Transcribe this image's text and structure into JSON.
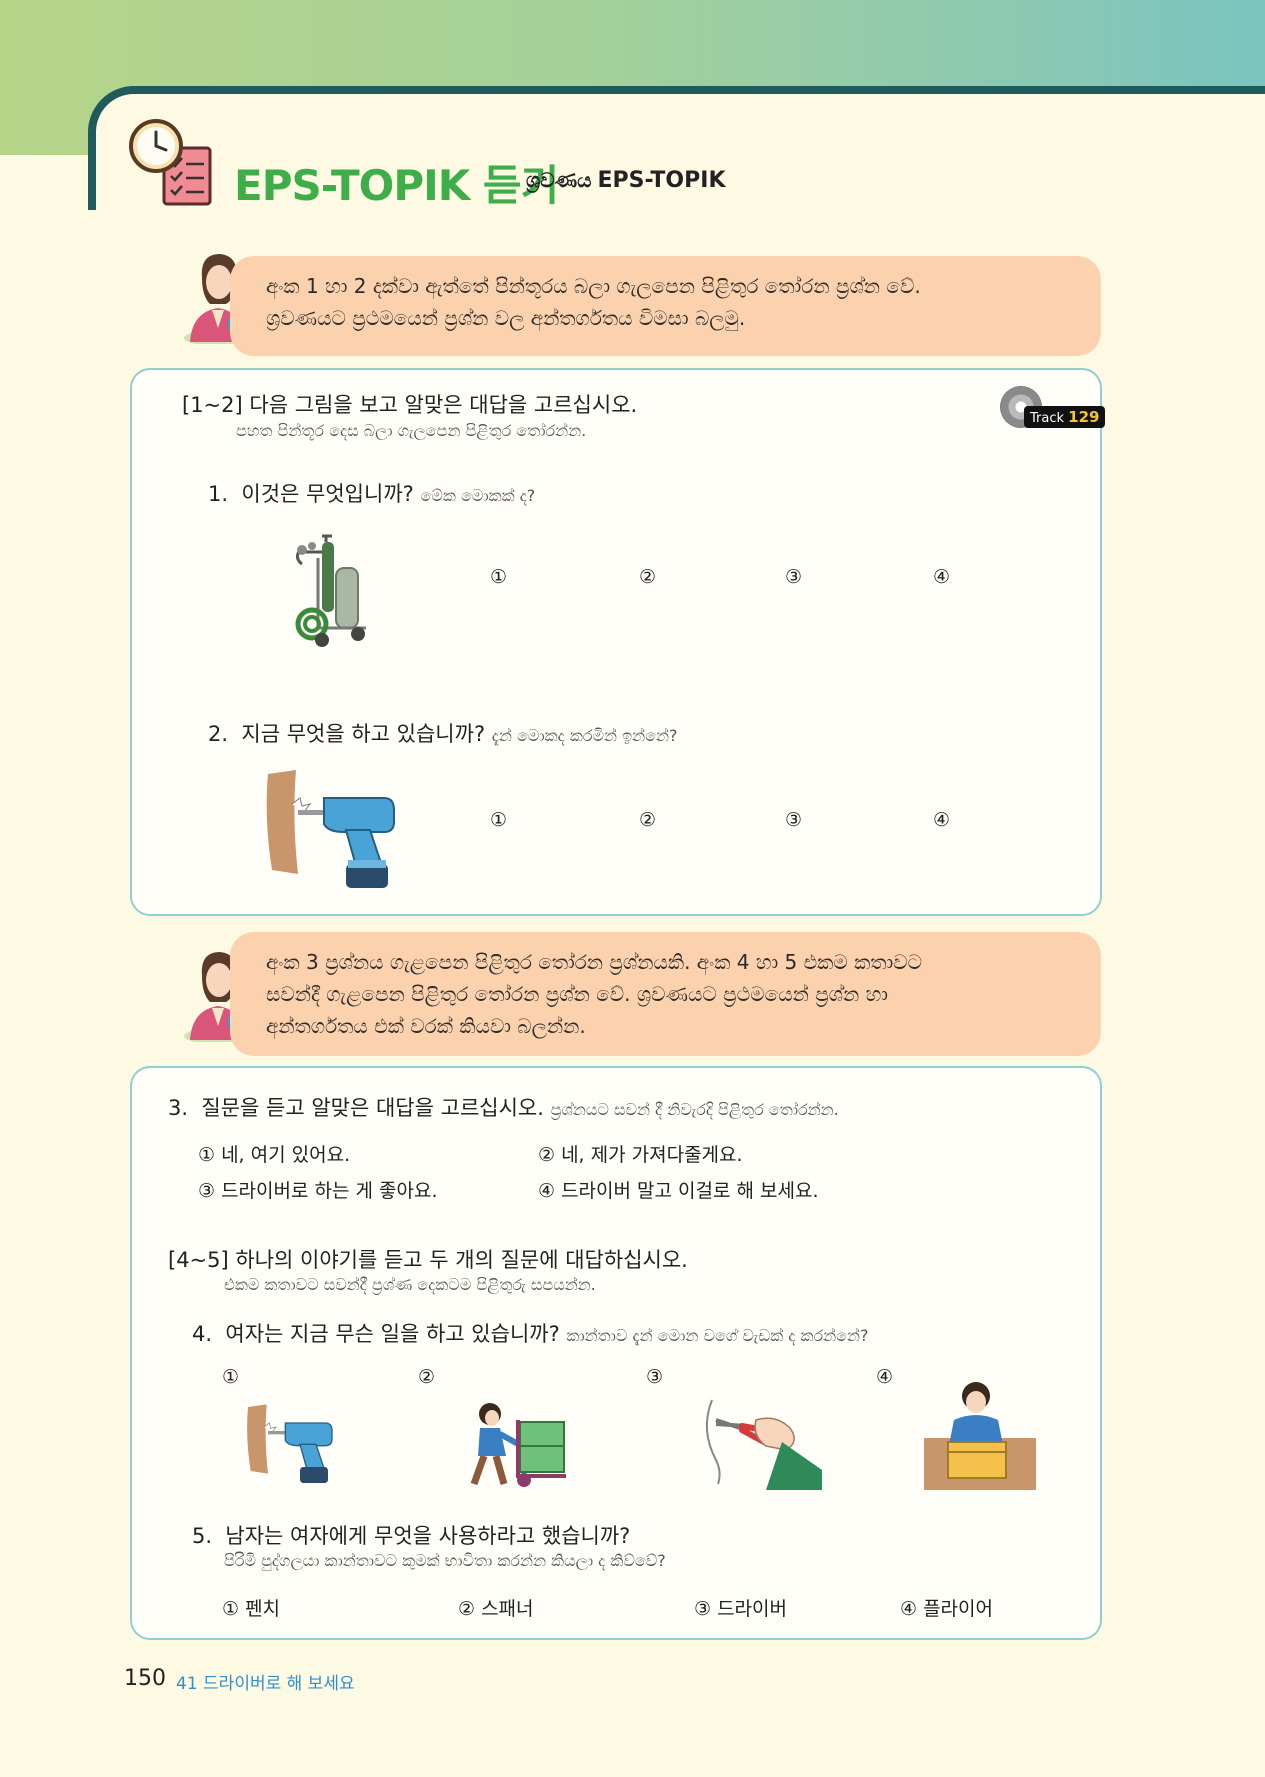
{
  "header": {
    "title": "EPS-TOPIK 듣기",
    "subtitle_si": "ශ්‍රවණය",
    "subtitle_eps": "EPS-TOPIK"
  },
  "bubble1": {
    "line1": "අංක 1 හා 2 දක්වා ඇත්තේ පින්තූරය බලා ගැලපෙන පිළිතුර තෝරන ප්‍රශ්න වේ.",
    "line2": "ශ්‍රවණයට ප්‍රථමයෙන් ප්‍රශ්න වල අන්තර්ගතය විමසා බලමු."
  },
  "section1": {
    "heading": "[1~2] 다음 그림을 보고 알맞은 대답을 고르십시오.",
    "heading_si": "පහත පින්තූර දෙස බලා ගැලපෙන පිළිතුර තෝරන්න.",
    "track_label": "Track",
    "track_number": "129",
    "q1": {
      "number": "1.",
      "text": "이것은 무엇입니까?",
      "text_si": "මේක මොකක් ද?",
      "options": [
        "①",
        "②",
        "③",
        "④"
      ]
    },
    "q2": {
      "number": "2.",
      "text": "지금 무엇을 하고 있습니까?",
      "text_si": "දැන් මොකද කරමින් ඉන්නේ?",
      "options": [
        "①",
        "②",
        "③",
        "④"
      ]
    }
  },
  "bubble2": {
    "line1": "අංක 3 ප්‍රශ්නය ගැළපෙන පිළිතුර තෝරන ප්‍රශ්නයකි. අංක 4 හා 5 එකම කතාවට",
    "line2": "සවන්දී ගැළපෙන පිළිතුර තෝරන ප්‍රශ්න වේ. ශ්‍රවණයට ප්‍රථමයෙන් ප්‍රශ්න හා",
    "line3": "අන්තර්ගතය එක් වරක් කියවා බලන්න."
  },
  "section2": {
    "q3": {
      "number": "3.",
      "text": "질문을 듣고 알맞은 대답을 고르십시오.",
      "text_si": "ප්‍රශ්නයට සවන් දී නිවැරදි පිළිතුර තෝරන්න.",
      "options": [
        "① 네, 여기 있어요.",
        "② 네, 제가 가져다줄게요.",
        "③ 드라이버로 하는 게 좋아요.",
        "④ 드라이버 말고 이걸로 해 보세요."
      ]
    },
    "heading": "[4~5] 하나의 이야기를 듣고 두 개의 질문에 대답하십시오.",
    "heading_si": "එකම කතාවට සවන්දී ප්‍රශ්ණ දෙකටම පිළිතුරු සපයන්න.",
    "q4": {
      "number": "4.",
      "text": "여자는 지금 무슨 일을 하고 있습니까?",
      "text_si": "කාන්තාව දැන් මොන වගේ වැඩක් ද කරන්නේ?",
      "options": [
        "①",
        "②",
        "③",
        "④"
      ]
    },
    "q5": {
      "number": "5.",
      "text": "남자는 여자에게 무엇을 사용하라고 했습니까?",
      "text_si": "පිරිමි පුද්ගලයා කාන්තාවට කුමක් භාවිතා කරන්න කියලා ද කිව්වේ?",
      "options": [
        "① 펜치",
        "② 스패너",
        "③ 드라이버",
        "④ 플라이어"
      ]
    }
  },
  "footer": {
    "page_number": "150",
    "lesson": "41 드라이버로 해 보세요"
  }
}
